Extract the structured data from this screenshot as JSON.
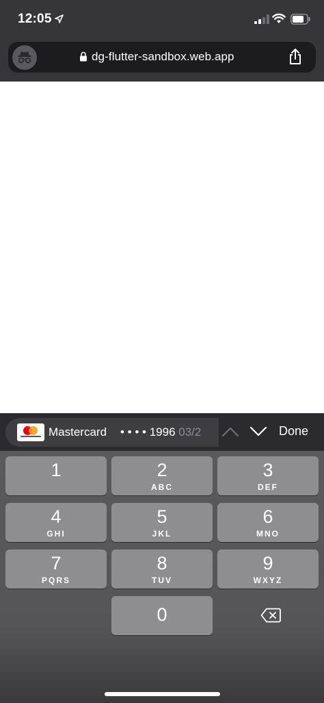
{
  "status": {
    "time": "12:05"
  },
  "browser": {
    "url": "dg-flutter-sandbox.web.app"
  },
  "autofill": {
    "card_name": "Mastercard",
    "card_mask": "• • • • 1996",
    "card_exp": "03/2",
    "done_label": "Done"
  },
  "keys": [
    {
      "digit": "1",
      "letters": ""
    },
    {
      "digit": "2",
      "letters": "ABC"
    },
    {
      "digit": "3",
      "letters": "DEF"
    },
    {
      "digit": "4",
      "letters": "GHI"
    },
    {
      "digit": "5",
      "letters": "JKL"
    },
    {
      "digit": "6",
      "letters": "MNO"
    },
    {
      "digit": "7",
      "letters": "PQRS"
    },
    {
      "digit": "8",
      "letters": "TUV"
    },
    {
      "digit": "9",
      "letters": "WXYZ"
    },
    {
      "digit": "0",
      "letters": ""
    }
  ],
  "icons": {
    "incognito": "incognito-icon",
    "lock": "lock-icon",
    "share": "share-icon",
    "backspace": "backspace-icon"
  }
}
